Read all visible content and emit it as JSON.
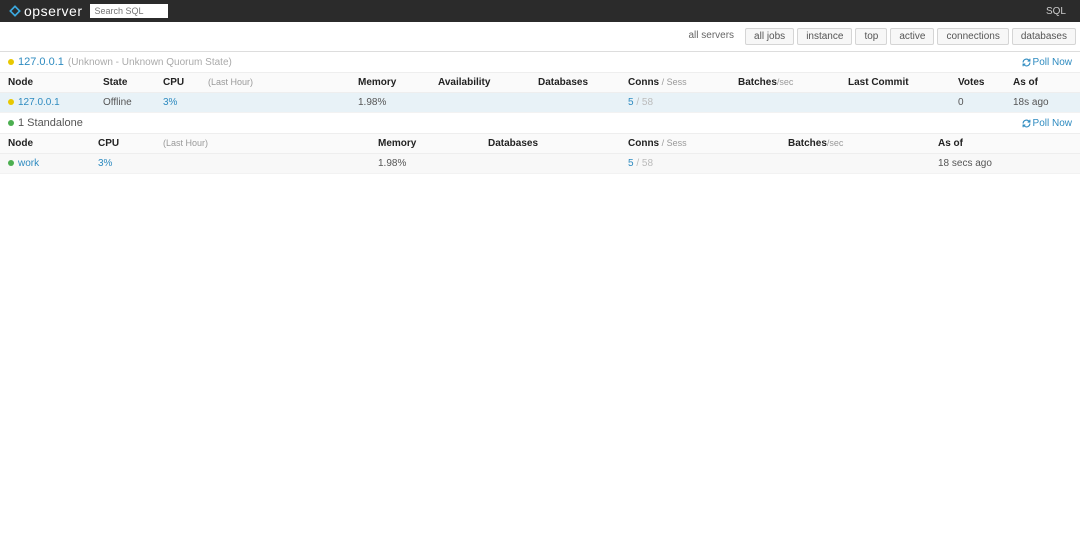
{
  "nav": {
    "brand_light": "op",
    "brand_bold": "server",
    "search_placeholder": "Search SQL",
    "right_link": "SQL"
  },
  "tabs": {
    "all_servers": "all servers",
    "all_jobs": "all jobs",
    "instance": "instance",
    "top": "top",
    "active": "active",
    "connections": "connections",
    "databases": "databases"
  },
  "poll_now_label": "Poll Now",
  "cluster1": {
    "name": "127.0.0.1",
    "meta": "(Unknown - Unknown Quorum State)",
    "headers": {
      "node": "Node",
      "state": "State",
      "cpu": "CPU",
      "cpu_hint": "(Last Hour)",
      "memory": "Memory",
      "availability": "Availability",
      "databases": "Databases",
      "conns": "Conns",
      "conns_suffix": " / Sess",
      "batches": "Batches",
      "batches_suffix": "/sec",
      "last_commit": "Last Commit",
      "votes": "Votes",
      "asof": "As of"
    },
    "row": {
      "node": "127.0.0.1",
      "state": "Offline",
      "cpu": "3%",
      "memory": "1.98%",
      "availability": "",
      "databases": "",
      "conns": "5",
      "conns_sess": " / 58",
      "batches": "",
      "last_commit": "",
      "votes": "0",
      "asof": "18s ago"
    }
  },
  "cluster2": {
    "name": "1 Standalone",
    "headers": {
      "node": "Node",
      "cpu": "CPU",
      "cpu_hint": "(Last Hour)",
      "memory": "Memory",
      "databases": "Databases",
      "conns": "Conns",
      "conns_suffix": " / Sess",
      "batches": "Batches",
      "batches_suffix": "/sec",
      "asof": "As of"
    },
    "row": {
      "node": "work",
      "cpu": "3%",
      "memory": "1.98%",
      "databases": "",
      "conns": "5",
      "conns_sess": " / 58",
      "batches": "",
      "asof": "18 secs ago"
    }
  }
}
